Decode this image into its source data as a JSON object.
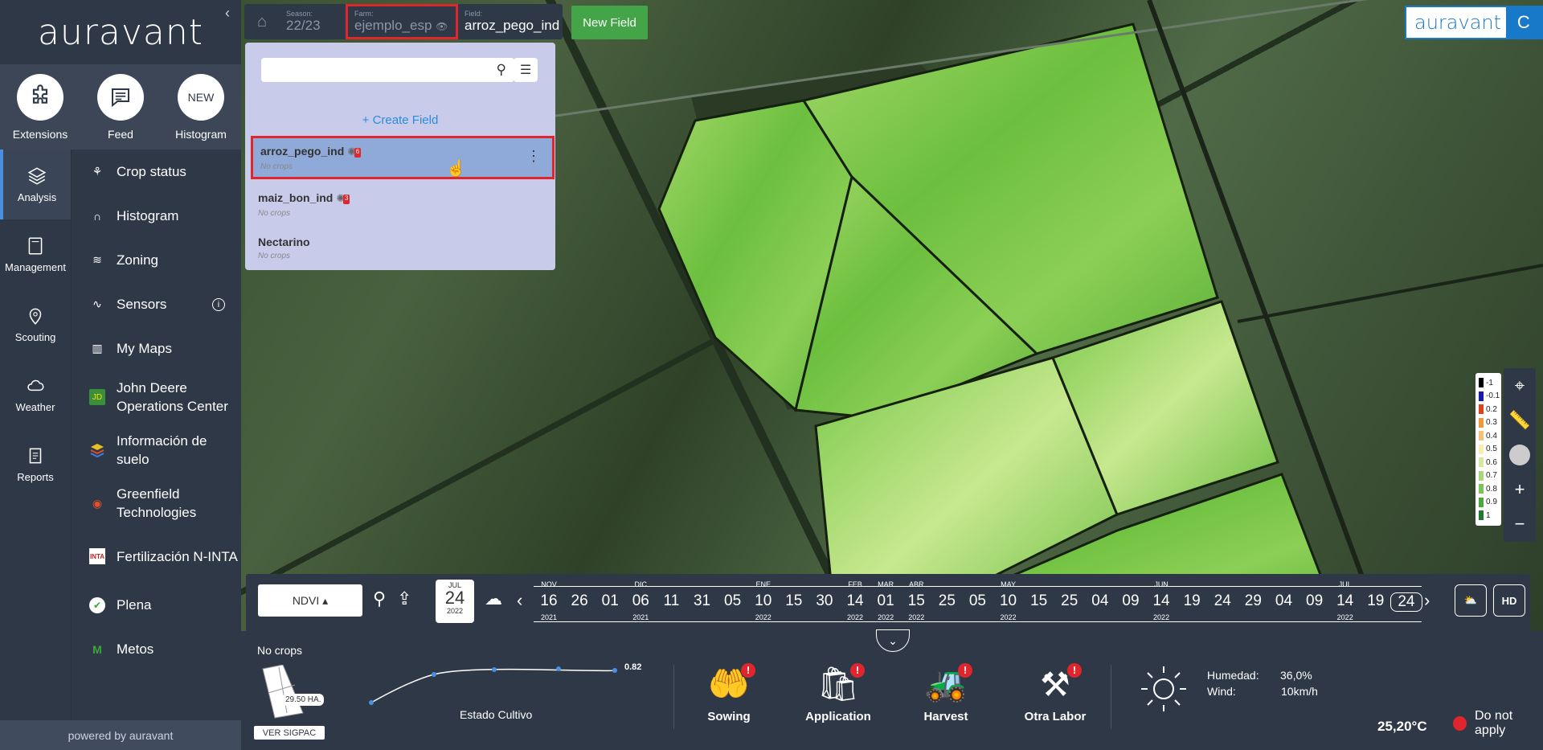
{
  "brand": {
    "logo_text": "auravant",
    "corner_logo": "auravant",
    "corner_letter": "C",
    "powered_by": "powered by auravant"
  },
  "top_icons": [
    {
      "label": "Extensions",
      "icon": "puzzle-icon"
    },
    {
      "label": "Feed",
      "icon": "feed-icon"
    },
    {
      "label": "Histogram",
      "badge": "NEW"
    }
  ],
  "categories": [
    {
      "label": "Analysis",
      "icon": "layers-icon",
      "active": true
    },
    {
      "label": "Management",
      "icon": "book-icon"
    },
    {
      "label": "Scouting",
      "icon": "pin-icon"
    },
    {
      "label": "Weather",
      "icon": "cloud-icon"
    },
    {
      "label": "Reports",
      "icon": "report-icon"
    }
  ],
  "menu": [
    {
      "label": "Crop status",
      "icon": "plant-icon"
    },
    {
      "label": "Histogram",
      "icon": "curve-icon"
    },
    {
      "label": "Zoning",
      "icon": "layers-icon"
    },
    {
      "label": "Sensors",
      "icon": "pulse-icon",
      "info": "i"
    },
    {
      "label": "My Maps",
      "icon": "map-icon"
    },
    {
      "label": "John Deere Operations Center",
      "icon": "jd-icon"
    },
    {
      "label": "Información de suelo",
      "icon": "soil-icon"
    },
    {
      "label": "Greenfield Technologies",
      "icon": "greenfield-icon"
    },
    {
      "label": "Fertilización N-INTA",
      "icon": "inta-icon",
      "icon_text": "INTA"
    },
    {
      "label": "Plena",
      "icon": "check-icon"
    },
    {
      "label": "Metos",
      "icon": "metos-icon",
      "icon_text": "M"
    }
  ],
  "topbar": {
    "season_key": "Season:",
    "season_value": "22/23",
    "farm_key": "Farm:",
    "farm_value": "ejemplo_esp",
    "field_key": "Field:",
    "field_value": "arroz_pego_ind",
    "new_field": "New Field"
  },
  "field_panel": {
    "search_placeholder": "",
    "create_label": "+ Create Field",
    "fields": [
      {
        "name": "arroz_pego_ind",
        "sub": "No crops",
        "badge": "6",
        "selected": true
      },
      {
        "name": "maiz_bon_ind",
        "sub": "No crops",
        "badge": "3"
      },
      {
        "name": "Nectarino",
        "sub": "No crops"
      }
    ]
  },
  "legend": {
    "items": [
      {
        "label": "-1",
        "color": "#000000"
      },
      {
        "label": "-0.1",
        "color": "#1a1aa8"
      },
      {
        "label": "0.2",
        "color": "#d9461e"
      },
      {
        "label": "0.3",
        "color": "#f09b3a"
      },
      {
        "label": "0.4",
        "color": "#f3c27a"
      },
      {
        "label": "0.5",
        "color": "#f6efb4"
      },
      {
        "label": "0.6",
        "color": "#d3eba0"
      },
      {
        "label": "0.7",
        "color": "#a9d77b"
      },
      {
        "label": "0.8",
        "color": "#7cc25a"
      },
      {
        "label": "0.9",
        "color": "#4aa83d"
      },
      {
        "label": "1",
        "color": "#1f7a30"
      }
    ]
  },
  "timeline": {
    "index": "NDVI",
    "current": {
      "month": "JUL",
      "day": "24",
      "year": "2022"
    },
    "dates": [
      {
        "mo": "NOV",
        "dd": "16",
        "yr": "2021"
      },
      {
        "mo": "",
        "dd": "26",
        "yr": ""
      },
      {
        "mo": "",
        "dd": "01",
        "yr": ""
      },
      {
        "mo": "DIC",
        "dd": "06",
        "yr": "2021"
      },
      {
        "mo": "",
        "dd": "11",
        "yr": ""
      },
      {
        "mo": "",
        "dd": "31",
        "yr": ""
      },
      {
        "mo": "",
        "dd": "05",
        "yr": ""
      },
      {
        "mo": "ENE",
        "dd": "10",
        "yr": "2022"
      },
      {
        "mo": "",
        "dd": "15",
        "yr": ""
      },
      {
        "mo": "",
        "dd": "30",
        "yr": ""
      },
      {
        "mo": "FEB",
        "dd": "14",
        "yr": "2022"
      },
      {
        "mo": "MAR",
        "dd": "01",
        "yr": "2022"
      },
      {
        "mo": "ABR",
        "dd": "15",
        "yr": "2022"
      },
      {
        "mo": "",
        "dd": "25",
        "yr": ""
      },
      {
        "mo": "",
        "dd": "05",
        "yr": ""
      },
      {
        "mo": "MAY",
        "dd": "10",
        "yr": "2022"
      },
      {
        "mo": "",
        "dd": "15",
        "yr": ""
      },
      {
        "mo": "",
        "dd": "25",
        "yr": ""
      },
      {
        "mo": "",
        "dd": "04",
        "yr": ""
      },
      {
        "mo": "",
        "dd": "09",
        "yr": ""
      },
      {
        "mo": "JUN",
        "dd": "14",
        "yr": "2022"
      },
      {
        "mo": "",
        "dd": "19",
        "yr": ""
      },
      {
        "mo": "",
        "dd": "24",
        "yr": ""
      },
      {
        "mo": "",
        "dd": "29",
        "yr": ""
      },
      {
        "mo": "",
        "dd": "04",
        "yr": ""
      },
      {
        "mo": "",
        "dd": "09",
        "yr": ""
      },
      {
        "mo": "JUL",
        "dd": "14",
        "yr": "2022"
      },
      {
        "mo": "",
        "dd": "19",
        "yr": ""
      },
      {
        "mo": "",
        "dd": "24",
        "yr": "",
        "current": true
      }
    ],
    "hd_label": "HD"
  },
  "bottom": {
    "no_crops": "No crops",
    "area": "29.50 HA.",
    "sigpac": "VER SIGPAC",
    "curve_value": "0.82",
    "curve_label": "Estado Cultivo",
    "labors": [
      {
        "label": "Sowing",
        "icon": "sowing-icon"
      },
      {
        "label": "Application",
        "icon": "application-icon"
      },
      {
        "label": "Harvest",
        "icon": "harvest-icon"
      },
      {
        "label": "Otra Labor",
        "icon": "shovel-icon"
      }
    ],
    "weather": {
      "temp": "25,20°C",
      "humidity_key": "Humedad:",
      "humidity_value": "36,0%",
      "wind_key": "Wind:",
      "wind_value": "10km/h",
      "apply_status": "Do not apply"
    }
  }
}
